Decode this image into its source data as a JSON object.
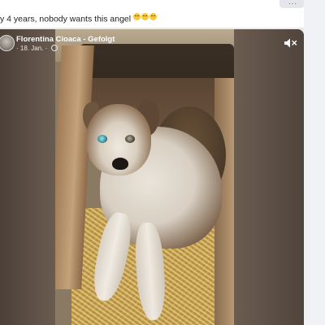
{
  "post": {
    "caption": "y 4 years, nobody wants this angel",
    "caption_emojis": [
      "sad-face-emoji",
      "sad-face-emoji",
      "sad-face-emoji"
    ],
    "author": "Florentina Cioaca - Gefolgt",
    "meta_prefix": "·",
    "date": "18. Jan.",
    "meta_separator": "·",
    "privacy_icon": "globe-icon"
  },
  "toolbar": {
    "more_label": "···"
  },
  "video": {
    "mute_icon": "speaker-muted-icon"
  },
  "colors": {
    "caption_text": "#1c1e21",
    "overlay_text": "#ffffff",
    "page_background": "#e9ebee"
  }
}
